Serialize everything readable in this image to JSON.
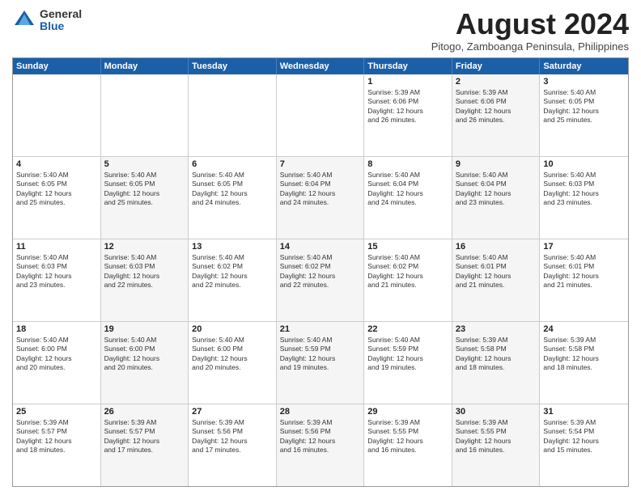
{
  "logo": {
    "general": "General",
    "blue": "Blue"
  },
  "title": "August 2024",
  "subtitle": "Pitogo, Zamboanga Peninsula, Philippines",
  "header_days": [
    "Sunday",
    "Monday",
    "Tuesday",
    "Wednesday",
    "Thursday",
    "Friday",
    "Saturday"
  ],
  "weeks": [
    [
      {
        "day": "",
        "text": "",
        "shaded": false
      },
      {
        "day": "",
        "text": "",
        "shaded": false
      },
      {
        "day": "",
        "text": "",
        "shaded": false
      },
      {
        "day": "",
        "text": "",
        "shaded": false
      },
      {
        "day": "1",
        "text": "Sunrise: 5:39 AM\nSunset: 6:06 PM\nDaylight: 12 hours\nand 26 minutes.",
        "shaded": false
      },
      {
        "day": "2",
        "text": "Sunrise: 5:39 AM\nSunset: 6:06 PM\nDaylight: 12 hours\nand 26 minutes.",
        "shaded": true
      },
      {
        "day": "3",
        "text": "Sunrise: 5:40 AM\nSunset: 6:05 PM\nDaylight: 12 hours\nand 25 minutes.",
        "shaded": false
      }
    ],
    [
      {
        "day": "4",
        "text": "Sunrise: 5:40 AM\nSunset: 6:05 PM\nDaylight: 12 hours\nand 25 minutes.",
        "shaded": false
      },
      {
        "day": "5",
        "text": "Sunrise: 5:40 AM\nSunset: 6:05 PM\nDaylight: 12 hours\nand 25 minutes.",
        "shaded": true
      },
      {
        "day": "6",
        "text": "Sunrise: 5:40 AM\nSunset: 6:05 PM\nDaylight: 12 hours\nand 24 minutes.",
        "shaded": false
      },
      {
        "day": "7",
        "text": "Sunrise: 5:40 AM\nSunset: 6:04 PM\nDaylight: 12 hours\nand 24 minutes.",
        "shaded": true
      },
      {
        "day": "8",
        "text": "Sunrise: 5:40 AM\nSunset: 6:04 PM\nDaylight: 12 hours\nand 24 minutes.",
        "shaded": false
      },
      {
        "day": "9",
        "text": "Sunrise: 5:40 AM\nSunset: 6:04 PM\nDaylight: 12 hours\nand 23 minutes.",
        "shaded": true
      },
      {
        "day": "10",
        "text": "Sunrise: 5:40 AM\nSunset: 6:03 PM\nDaylight: 12 hours\nand 23 minutes.",
        "shaded": false
      }
    ],
    [
      {
        "day": "11",
        "text": "Sunrise: 5:40 AM\nSunset: 6:03 PM\nDaylight: 12 hours\nand 23 minutes.",
        "shaded": false
      },
      {
        "day": "12",
        "text": "Sunrise: 5:40 AM\nSunset: 6:03 PM\nDaylight: 12 hours\nand 22 minutes.",
        "shaded": true
      },
      {
        "day": "13",
        "text": "Sunrise: 5:40 AM\nSunset: 6:02 PM\nDaylight: 12 hours\nand 22 minutes.",
        "shaded": false
      },
      {
        "day": "14",
        "text": "Sunrise: 5:40 AM\nSunset: 6:02 PM\nDaylight: 12 hours\nand 22 minutes.",
        "shaded": true
      },
      {
        "day": "15",
        "text": "Sunrise: 5:40 AM\nSunset: 6:02 PM\nDaylight: 12 hours\nand 21 minutes.",
        "shaded": false
      },
      {
        "day": "16",
        "text": "Sunrise: 5:40 AM\nSunset: 6:01 PM\nDaylight: 12 hours\nand 21 minutes.",
        "shaded": true
      },
      {
        "day": "17",
        "text": "Sunrise: 5:40 AM\nSunset: 6:01 PM\nDaylight: 12 hours\nand 21 minutes.",
        "shaded": false
      }
    ],
    [
      {
        "day": "18",
        "text": "Sunrise: 5:40 AM\nSunset: 6:00 PM\nDaylight: 12 hours\nand 20 minutes.",
        "shaded": false
      },
      {
        "day": "19",
        "text": "Sunrise: 5:40 AM\nSunset: 6:00 PM\nDaylight: 12 hours\nand 20 minutes.",
        "shaded": true
      },
      {
        "day": "20",
        "text": "Sunrise: 5:40 AM\nSunset: 6:00 PM\nDaylight: 12 hours\nand 20 minutes.",
        "shaded": false
      },
      {
        "day": "21",
        "text": "Sunrise: 5:40 AM\nSunset: 5:59 PM\nDaylight: 12 hours\nand 19 minutes.",
        "shaded": true
      },
      {
        "day": "22",
        "text": "Sunrise: 5:40 AM\nSunset: 5:59 PM\nDaylight: 12 hours\nand 19 minutes.",
        "shaded": false
      },
      {
        "day": "23",
        "text": "Sunrise: 5:39 AM\nSunset: 5:58 PM\nDaylight: 12 hours\nand 18 minutes.",
        "shaded": true
      },
      {
        "day": "24",
        "text": "Sunrise: 5:39 AM\nSunset: 5:58 PM\nDaylight: 12 hours\nand 18 minutes.",
        "shaded": false
      }
    ],
    [
      {
        "day": "25",
        "text": "Sunrise: 5:39 AM\nSunset: 5:57 PM\nDaylight: 12 hours\nand 18 minutes.",
        "shaded": false
      },
      {
        "day": "26",
        "text": "Sunrise: 5:39 AM\nSunset: 5:57 PM\nDaylight: 12 hours\nand 17 minutes.",
        "shaded": true
      },
      {
        "day": "27",
        "text": "Sunrise: 5:39 AM\nSunset: 5:56 PM\nDaylight: 12 hours\nand 17 minutes.",
        "shaded": false
      },
      {
        "day": "28",
        "text": "Sunrise: 5:39 AM\nSunset: 5:56 PM\nDaylight: 12 hours\nand 16 minutes.",
        "shaded": true
      },
      {
        "day": "29",
        "text": "Sunrise: 5:39 AM\nSunset: 5:55 PM\nDaylight: 12 hours\nand 16 minutes.",
        "shaded": false
      },
      {
        "day": "30",
        "text": "Sunrise: 5:39 AM\nSunset: 5:55 PM\nDaylight: 12 hours\nand 16 minutes.",
        "shaded": true
      },
      {
        "day": "31",
        "text": "Sunrise: 5:39 AM\nSunset: 5:54 PM\nDaylight: 12 hours\nand 15 minutes.",
        "shaded": false
      }
    ]
  ]
}
